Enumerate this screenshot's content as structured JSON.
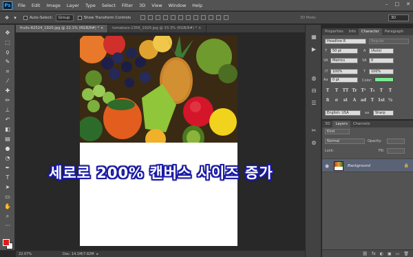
{
  "app": {
    "logo": "Ps",
    "menu": [
      "File",
      "Edit",
      "Image",
      "Layer",
      "Type",
      "Select",
      "Filter",
      "3D",
      "View",
      "Window",
      "Help"
    ],
    "window_controls": [
      "–",
      "□",
      "✕"
    ]
  },
  "options_bar": {
    "auto_select_label": "Auto-Select:",
    "auto_select_value": "Group",
    "transform_label": "Show Transform Controls",
    "mode_3d_label": "3D Mode:",
    "workspace": "3D"
  },
  "document_tabs": [
    {
      "label": "fruits-82524_1920.jpg @ 22.1% (RGB/8#) *  ×",
      "active": true
    },
    {
      "label": "tomatoes-1356_1920.jpg @ 33.3% (RGB/8#) *  ×",
      "active": false
    }
  ],
  "overlay_caption": "세로로 200% 캔버스 사이즈 증가",
  "status": {
    "zoom": "22.07%",
    "doc_size": "Doc: 14.1M/7.82M"
  },
  "character_panel": {
    "tabs": [
      "Properties",
      "Info",
      "Character",
      "Paragraph"
    ],
    "active_tab": "Character",
    "font_family": "Headline R",
    "font_style": "Regular",
    "font_size": "50 pt",
    "leading": "(Auto)",
    "kerning": "Metrics",
    "tracking": "0",
    "vertical_scale": "100%",
    "horizontal_scale": "100%",
    "baseline_shift": "0 pt",
    "color_label": "Color:",
    "color": "#7bea8f",
    "type_buttons": [
      "T",
      "T",
      "TT",
      "Tr",
      "T¹",
      "T₁",
      "T",
      "T"
    ],
    "opentype_buttons": [
      "fi",
      "σ",
      "st",
      "A",
      "ad",
      "T",
      "1st",
      "½"
    ],
    "language": "English: USA",
    "antialias_icon": "aa",
    "antialias": "Sharp"
  },
  "layers_panel": {
    "tabs": [
      "3D",
      "Layers",
      "Channels"
    ],
    "active_tab": "Layers",
    "filter_label": "Kind",
    "blend_mode": "Normal",
    "opacity_label": "Opacity:",
    "lock_label": "Lock:",
    "fill_label": "Fill:",
    "layer_name": "Background",
    "bottom_icons": [
      "⛓",
      "fx",
      "◐",
      "▣",
      "▭",
      "🗑"
    ]
  }
}
